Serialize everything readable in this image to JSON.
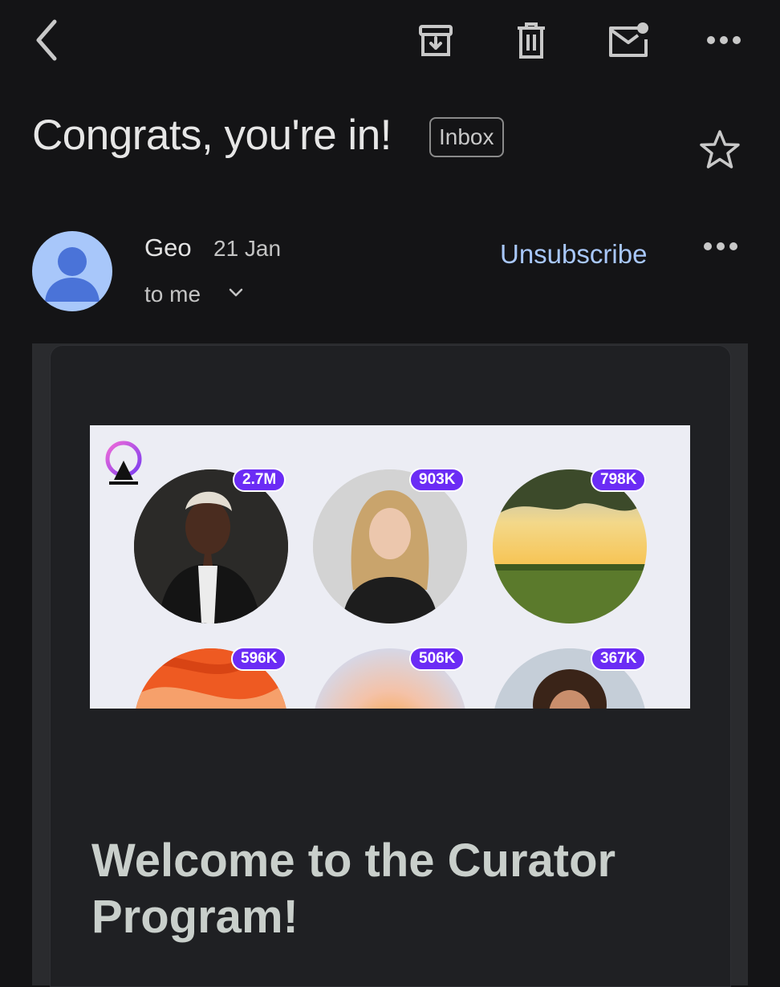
{
  "toolbar": {
    "back_icon": "chevron-left-icon",
    "archive_icon": "archive-icon",
    "delete_icon": "trash-icon",
    "mark_unread_icon": "mail-unread-icon",
    "more_icon": "more-horizontal-icon"
  },
  "email": {
    "subject": "Congrats, you're in!",
    "label": "Inbox",
    "sender": {
      "name": "Geo",
      "date": "21 Jan",
      "recipient": "to me"
    },
    "unsubscribe_label": "Unsubscribe"
  },
  "hero": {
    "profiles": [
      {
        "count": "2.7M",
        "kind": "portrait"
      },
      {
        "count": "903K",
        "kind": "portrait"
      },
      {
        "count": "798K",
        "kind": "landscape"
      },
      {
        "count": "596K",
        "kind": "abstract-orange"
      },
      {
        "count": "506K",
        "kind": "abstract-gradient"
      },
      {
        "count": "367K",
        "kind": "portrait"
      }
    ]
  },
  "body": {
    "heading": "Welcome to the Curator Program!"
  },
  "colors": {
    "background": "#141416",
    "accent_link": "#a8c7fa",
    "badge": "#6b2cf5",
    "heading": "#c9cfcb"
  }
}
